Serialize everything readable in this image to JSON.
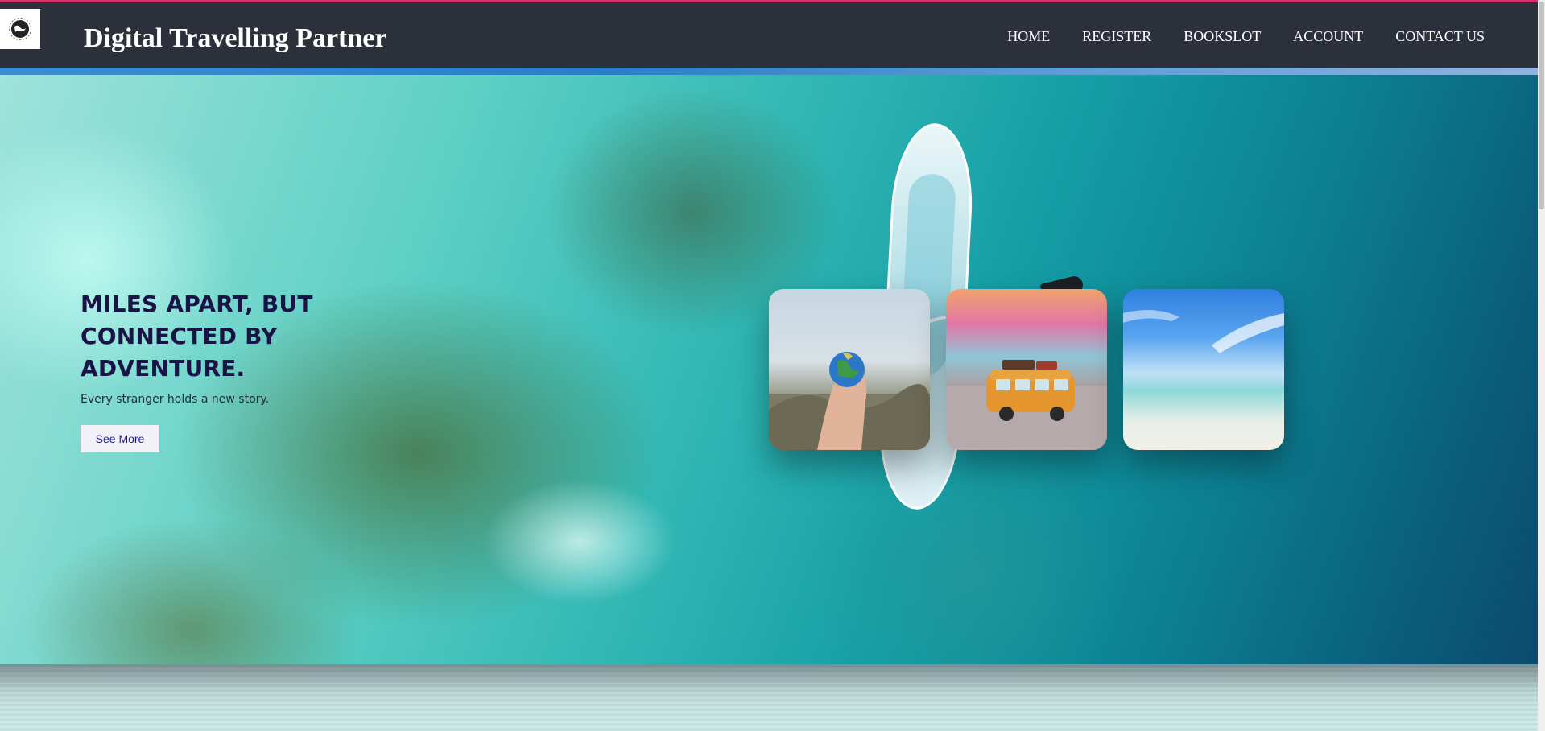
{
  "navbar": {
    "brand": "Digital Travelling Partner",
    "links": [
      "HOME",
      "REGISTER",
      "BOOKSLOT",
      "ACCOUNT",
      "CONTACT US"
    ]
  },
  "hero": {
    "heading": "MILES APART, BUT CONNECTED BY ADVENTURE.",
    "subtitle": "Every stranger holds a new story.",
    "button_label": "See More"
  },
  "slider": {
    "cards": [
      "globe-in-hand-image",
      "toy-van-image",
      "beach-image"
    ],
    "prev_icon": "arrow-left-icon",
    "next_icon": "arrow-right-icon"
  },
  "colors": {
    "navbar_bg": "#2b303a",
    "accent_top": "#d6336c",
    "heading": "#1a1446",
    "button_text": "#1b1aa8"
  }
}
